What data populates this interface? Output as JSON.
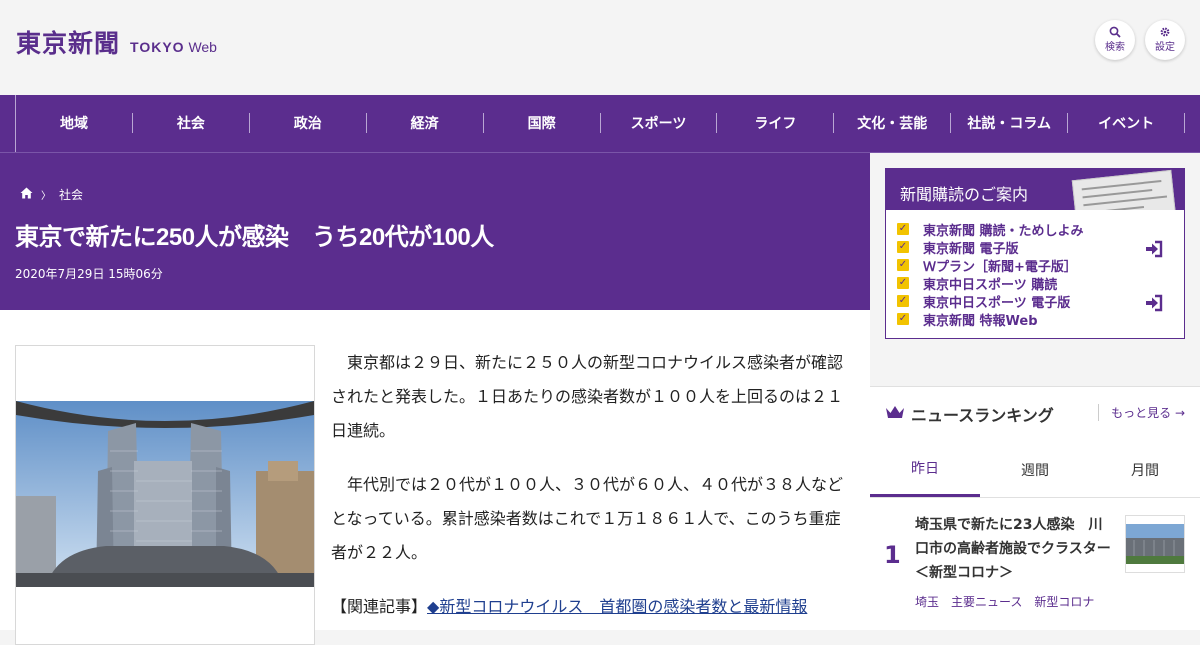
{
  "header": {
    "logo_jp": "東京新聞",
    "logo_en_bold": "TOKYO",
    "logo_en_light": "Web",
    "search_label": "検索",
    "settings_label": "設定"
  },
  "nav": {
    "items": [
      "地域",
      "社会",
      "政治",
      "経済",
      "国際",
      "スポーツ",
      "ライフ",
      "文化・芸能",
      "社説・コラム",
      "イベント"
    ]
  },
  "breadcrumb": {
    "category": "社会"
  },
  "article": {
    "title": "東京で新たに250人が感染　うち20代が100人",
    "date": "2020年7月29日 15時06分",
    "para1": "東京都は２９日、新たに２５０人の新型コロナウイルス感染者が確認されたと発表した。１日あたりの感染者数が１００人を上回るのは２１日連続。",
    "para2": "年代別では２０代が１００人、３０代が６０人、４０代が３８人などとなっている。累計感染者数はこれで１万１８６１人で、このうち重症者が２２人。",
    "related_prefix": "【関連記事】",
    "related_link": "◆新型コロナウイルス　首都圏の感染者数と最新情報"
  },
  "subscription": {
    "heading": "新聞購読のご案内",
    "items": [
      "東京新聞 購読・ためしよみ",
      "東京新聞 電子版",
      "Ｗプラン［新聞+電子版］",
      "東京中日スポーツ 購読",
      "東京中日スポーツ 電子版",
      "東京新聞 特報Web"
    ]
  },
  "ranking": {
    "heading": "ニュースランキング",
    "more": "もっと見る",
    "tabs": [
      "昨日",
      "週間",
      "月間"
    ],
    "items": [
      {
        "rank": "1",
        "title": "埼玉県で新たに23人感染　川口市の高齢者施設でクラスター＜新型コロナ＞",
        "tags": [
          "埼玉",
          "主要ニュース",
          "新型コロナ"
        ]
      }
    ]
  },
  "colors": {
    "brand": "#5b2d8e",
    "accent": "#f2c300"
  }
}
